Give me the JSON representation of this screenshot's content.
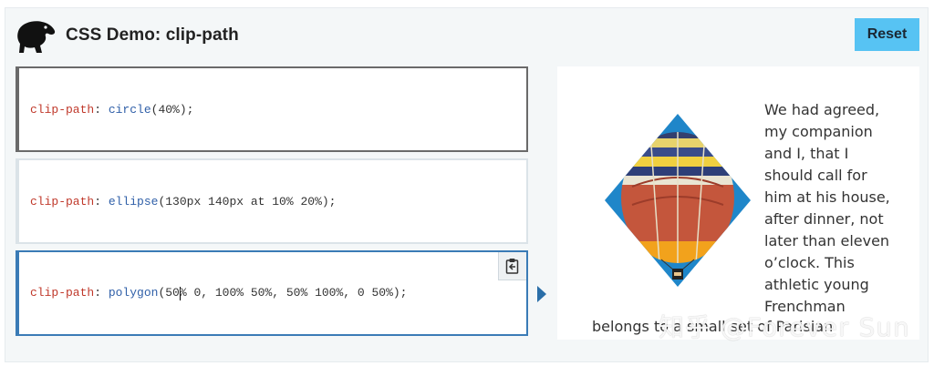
{
  "header": {
    "title": "CSS Demo: clip-path",
    "reset_label": "Reset"
  },
  "options": [
    {
      "property": "clip-path",
      "function": "circle",
      "args": "(40%);"
    },
    {
      "property": "clip-path",
      "function": "ellipse",
      "args": "(130px 140px at 10% 20%);"
    },
    {
      "property": "clip-path",
      "function": "polygon",
      "args_before_cursor": "(50",
      "args_after_cursor": "% 0, 100% 50%, 50% 100%, 0 50%);"
    }
  ],
  "selected_option": 3,
  "output": {
    "lines": [
      "We had agreed,",
      "my companion",
      "and I, that I",
      "should call for",
      "him at his house,",
      "after dinner, not",
      "later than eleven",
      "o’clock. This",
      "athletic young",
      "Frenchman"
    ],
    "last_line": "belongs to a small set of Parisian"
  },
  "watermark": "知乎 @Forever Sun",
  "colors": {
    "reset_bg": "#57c3f3",
    "selected_border": "#3a7bb6",
    "property": "#c0392b",
    "function": "#2f5fa8"
  },
  "icons": {
    "logo": "dinosaur-logo-icon",
    "copy": "clipboard-icon",
    "arrow": "play-arrow-icon"
  }
}
